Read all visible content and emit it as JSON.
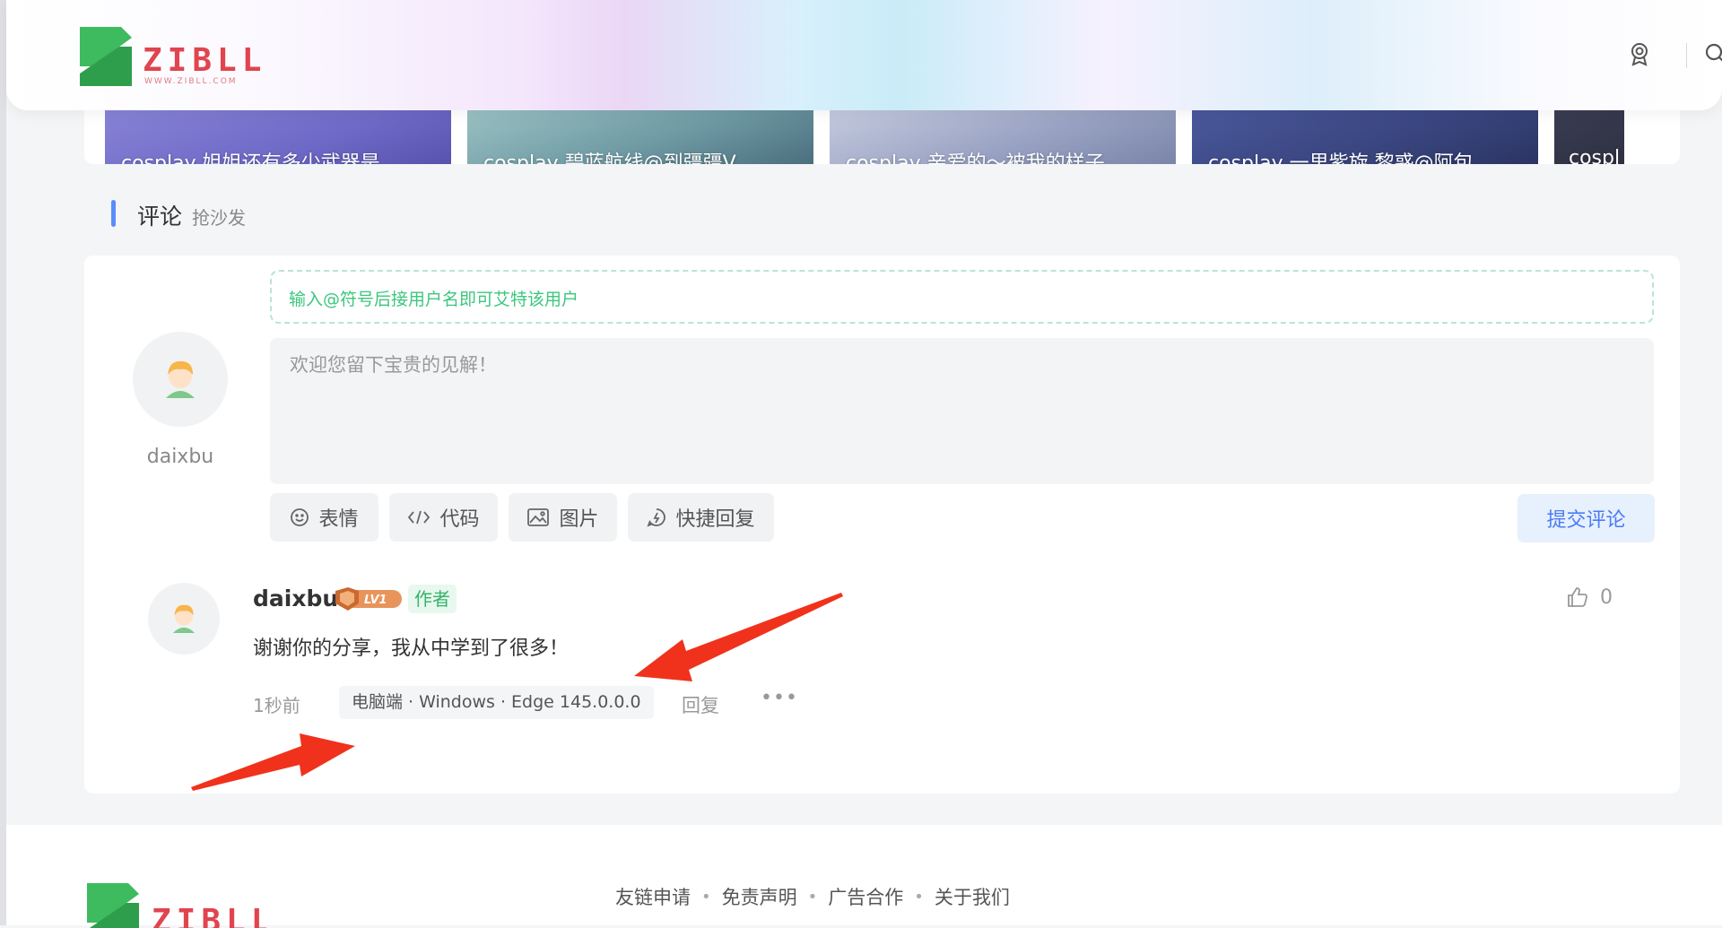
{
  "header": {
    "logo_text": "ZIBLL",
    "logo_subtext": "WWW.ZIBLL.COM"
  },
  "related_posts": [
    {
      "title": "cosplay 姐姐还有多少武器是…"
    },
    {
      "title": "cosplay 碧蓝航线@到疆疆V"
    },
    {
      "title": "cosplay 亲爱的～被我的样子…"
    },
    {
      "title": "cosplay 一里紫旋 黎惑@阿包…"
    },
    {
      "title": "cospl"
    }
  ],
  "comments_section": {
    "title": "评论",
    "subtitle": "抢沙发",
    "current_user": "daixbu",
    "mention_hint": "输入@符号后接用户名即可艾特该用户",
    "textarea_placeholder": "欢迎您留下宝贵的见解！",
    "toolbar": {
      "emoji_label": "表情",
      "code_label": "代码",
      "image_label": "图片",
      "quick_reply_label": "快捷回复",
      "submit_label": "提交评论"
    }
  },
  "comment": {
    "author": "daixbu",
    "level": "LV1",
    "author_tag": "作者",
    "text": "谢谢你的分享，我从中学到了很多！",
    "time": "1秒前",
    "device": "电脑端 · Windows · Edge 145.0.0.0",
    "reply_label": "回复",
    "more_label": "•••",
    "likes": "0"
  },
  "footer": {
    "links": [
      "友链申请",
      "免责声明",
      "广告合作",
      "关于我们"
    ]
  },
  "colors": {
    "accent_blue": "#5b8cfb",
    "logo_green": "#3dbb5e",
    "logo_red": "#e0454f",
    "author_green": "#36b36a",
    "arrow_red": "#f0321c"
  }
}
